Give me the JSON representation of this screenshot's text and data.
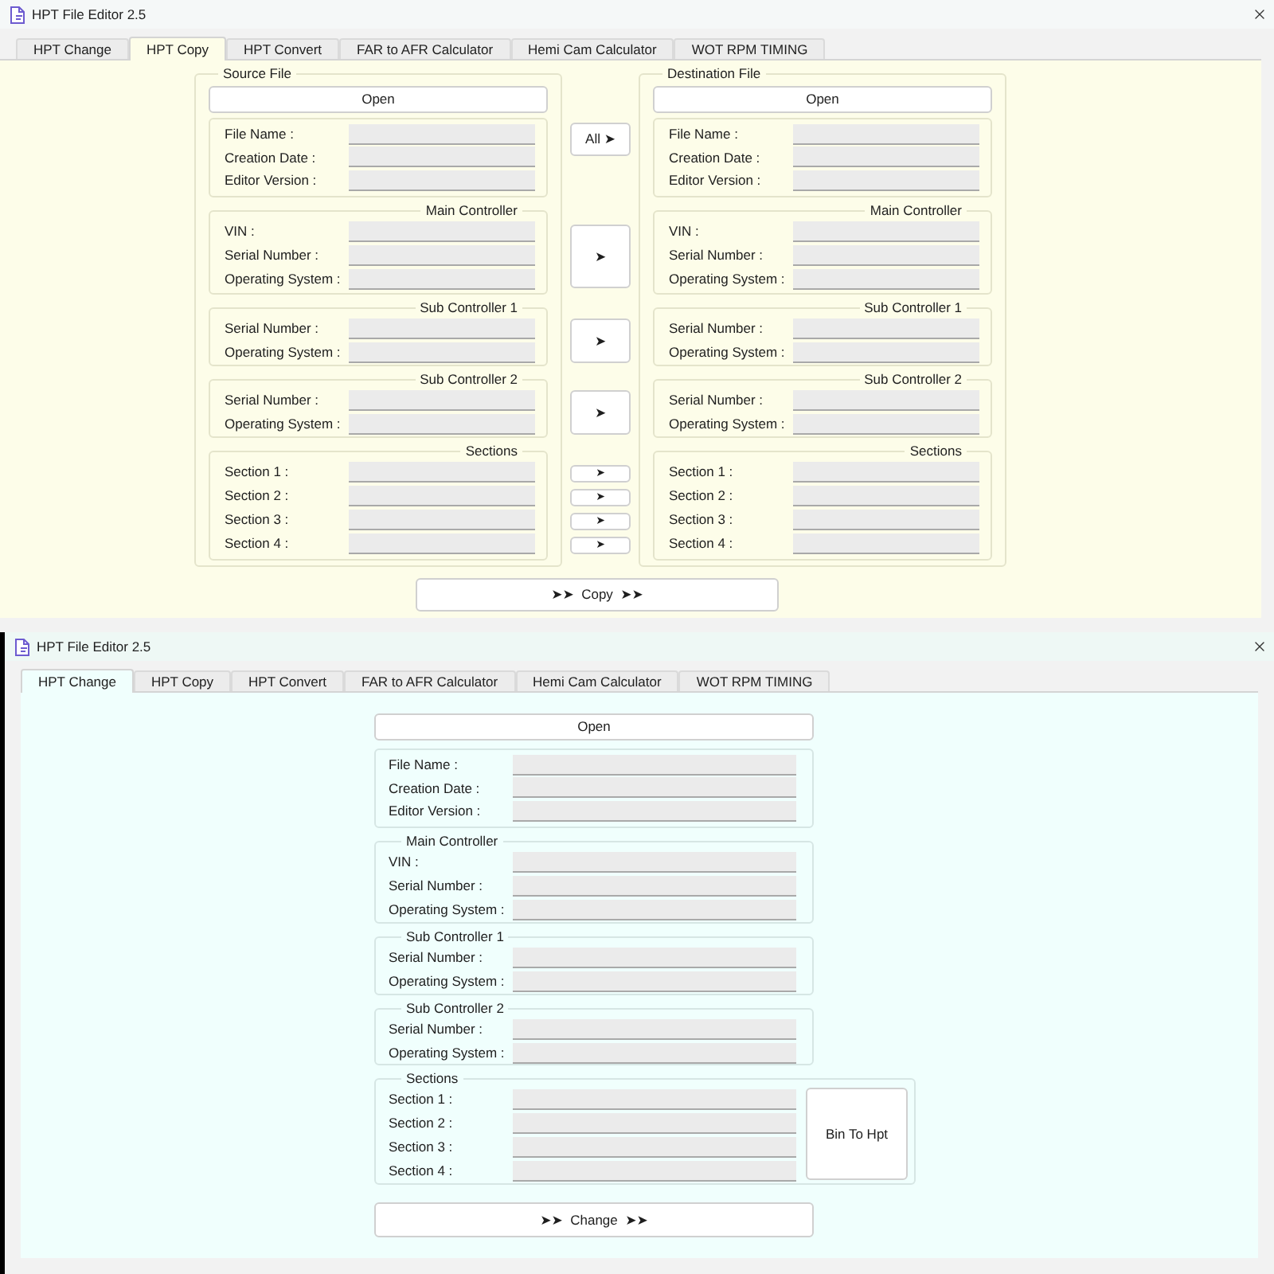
{
  "windows": [
    {
      "kind": "copy",
      "title": "HPT File Editor 2.5",
      "tabs": [
        {
          "label": "HPT Change",
          "selected": false
        },
        {
          "label": "HPT Copy",
          "selected": true
        },
        {
          "label": "HPT Convert",
          "selected": false
        },
        {
          "label": "FAR to AFR Calculator",
          "selected": false
        },
        {
          "label": "Hemi Cam Calculator",
          "selected": false
        },
        {
          "label": "WOT RPM TIMING",
          "selected": false
        }
      ],
      "source": {
        "legend": "Source File",
        "open_button": "Open",
        "file_info": [
          "File Name :",
          "Creation Date :",
          "Editor Version :"
        ],
        "groups": [
          {
            "legend": "Main Controller",
            "fields": [
              "VIN :",
              "Serial Number :",
              "Operating System :"
            ]
          },
          {
            "legend": "Sub Controller 1",
            "fields": [
              "Serial Number :",
              "Operating System :"
            ]
          },
          {
            "legend": "Sub Controller 2",
            "fields": [
              "Serial Number :",
              "Operating System :"
            ]
          },
          {
            "legend": "Sections",
            "fields": [
              "Section 1 :",
              "Section 2 :",
              "Section 3 :",
              "Section 4 :"
            ]
          }
        ]
      },
      "transfer": {
        "file_info": "All ➤",
        "groups": [
          [
            "➤"
          ],
          [
            "➤"
          ],
          [
            "➤"
          ],
          [
            "➤",
            "➤",
            "➤",
            "➤"
          ]
        ]
      },
      "destination": {
        "legend": "Destination File",
        "open_button": "Open",
        "file_info": [
          "File Name :",
          "Creation Date :",
          "Editor Version :"
        ],
        "groups": [
          {
            "legend": "Main Controller",
            "fields": [
              "VIN :",
              "Serial Number :",
              "Operating System :"
            ]
          },
          {
            "legend": "Sub Controller 1",
            "fields": [
              "Serial Number :",
              "Operating System :"
            ]
          },
          {
            "legend": "Sub Controller 2",
            "fields": [
              "Serial Number :",
              "Operating System :"
            ]
          },
          {
            "legend": "Sections",
            "fields": [
              "Section 1 :",
              "Section 2 :",
              "Section 3 :",
              "Section 4 :"
            ]
          }
        ]
      },
      "action_button": "➤➤  Copy  ➤➤"
    },
    {
      "kind": "change",
      "title": "HPT File Editor 2.5",
      "tabs": [
        {
          "label": "HPT Change",
          "selected": true
        },
        {
          "label": "HPT Copy",
          "selected": false
        },
        {
          "label": "HPT Convert",
          "selected": false
        },
        {
          "label": "FAR to AFR Calculator",
          "selected": false
        },
        {
          "label": "Hemi Cam Calculator",
          "selected": false
        },
        {
          "label": "WOT RPM TIMING",
          "selected": false
        }
      ],
      "file": {
        "open_button": "Open",
        "file_info": [
          "File Name :",
          "Creation Date :",
          "Editor Version :"
        ],
        "groups": [
          {
            "legend": "Main Controller",
            "fields": [
              "VIN :",
              "Serial Number :",
              "Operating System :"
            ]
          },
          {
            "legend": "Sub Controller 1",
            "fields": [
              "Serial Number :",
              "Operating System :"
            ]
          },
          {
            "legend": "Sub Controller 2",
            "fields": [
              "Serial Number :",
              "Operating System :"
            ]
          },
          {
            "legend": "Sections",
            "fields": [
              "Section 1 :",
              "Section 2 :",
              "Section 3 :",
              "Section 4 :"
            ]
          }
        ]
      },
      "side_button": "Bin To Hpt",
      "action_button": "➤➤  Change  ➤➤"
    }
  ]
}
